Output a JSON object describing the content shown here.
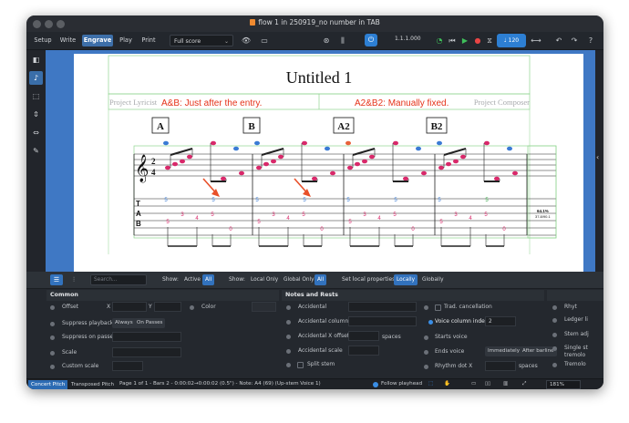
{
  "window": {
    "title": "flow 1 in 250919_no number in TAB"
  },
  "toolbar": {
    "modes": [
      "Setup",
      "Write",
      "Engrave",
      "Play",
      "Print"
    ],
    "active_mode": "Engrave",
    "layout_select": "Full score",
    "position": "1.1.1.000",
    "tempo_value": "120"
  },
  "left_tools": [
    "panel-toggle-icon",
    "note-icon",
    "frame-icon",
    "spacing-icon",
    "width-icon",
    "pen-icon"
  ],
  "score": {
    "title": "Untitled 1",
    "lyricist": "Project Lyricist",
    "composer": "Project Composer",
    "annotation_left": "A&B: Just after the entry.",
    "annotation_right": "A2&B2: Manually fixed.",
    "rehearsal_marks": [
      "A",
      "B",
      "A2",
      "B2"
    ],
    "time_signature": [
      "2",
      "4"
    ],
    "tab_label": [
      "T",
      "A",
      "B"
    ],
    "tab_numbers": [
      "5",
      "3",
      "4",
      "5",
      "0",
      "5",
      "3",
      "4",
      "5",
      "0",
      "5",
      "3",
      "4",
      "5",
      "0",
      "5",
      "3",
      "4",
      "5",
      "0"
    ],
    "tab_upper_numbers": [
      "5",
      "5",
      "5",
      "5",
      "5",
      "5",
      "5",
      "5"
    ],
    "frame_info": [
      "64.1%",
      "37.8/90.1"
    ],
    "colors": {
      "annotation": "#e53219",
      "arrow": "#e8502a",
      "note_pink": "#d9286a",
      "note_blue": "#3a7bd5",
      "note_green": "#3aa84a",
      "frame": "#7ed07e"
    }
  },
  "properties_bar": {
    "search_placeholder": "Search...",
    "show_label": "Show:",
    "show_options": [
      "Active",
      "All"
    ],
    "show_label2": "Show:",
    "show_options2": [
      "Local Only",
      "Global Only",
      "All"
    ],
    "set_local_label": "Set local properties:",
    "set_local_options": [
      "Locally",
      "Globally"
    ]
  },
  "groups": {
    "common": {
      "header": "Common",
      "offset": "Offset",
      "x_label": "X",
      "y_label": "Y",
      "color": "Color",
      "suppress_playback": "Suppress playback",
      "always": "Always",
      "on_passes": "On Passes",
      "suppress_on_passes": "Suppress on passes",
      "scale": "Scale",
      "custom_scale": "Custom scale"
    },
    "notes": {
      "header": "Notes and Rests",
      "accidental": "Accidental",
      "accidental_column": "Accidental column",
      "accidental_x_offset": "Accidental X offset",
      "spaces": "spaces",
      "accidental_scale": "Accidental scale",
      "split_stem": "Split stem",
      "trad_cancellation": "Trad. cancellation",
      "voice_column_index": "Voice column index",
      "voice_column_value": "2",
      "starts_voice": "Starts voice",
      "ends_voice": "Ends voice",
      "immediately": "Immediately",
      "after_barline": "After barline",
      "rhythm_dot_x": "Rhythm dot X",
      "spaces2": "spaces"
    },
    "right": [
      "Rhyt",
      "Ledger li",
      "Stem adj",
      "Single st",
      "tremolo",
      "Tremolo"
    ]
  },
  "status": {
    "concert_pitch": "Concert Pitch",
    "transposed_pitch": "Transposed Pitch",
    "info": "Page 1 of 1 - Bars 2 - 0:00:02→0:00:02 (0.5\") - Note: A4 (69) (Up-stem Voice 1)",
    "follow_playhead": "Follow playhead",
    "zoom": "181%"
  }
}
